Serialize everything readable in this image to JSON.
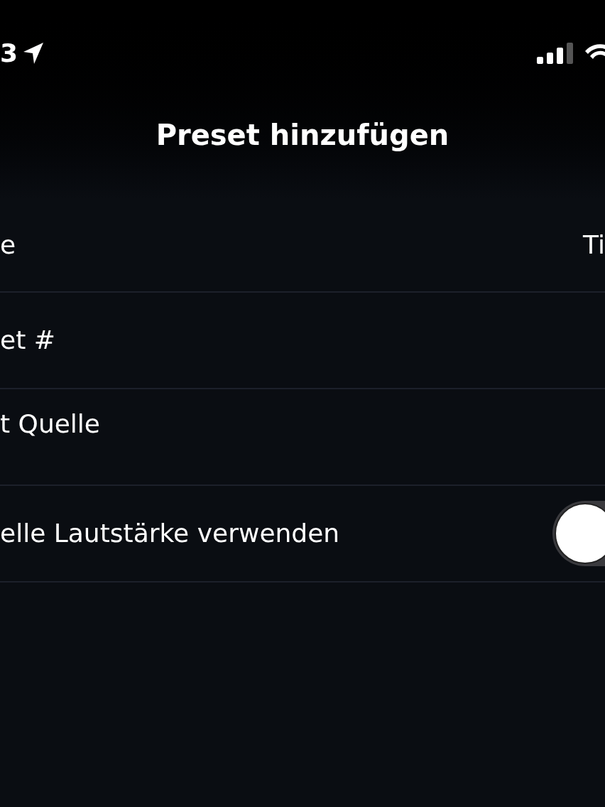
{
  "status_bar": {
    "time": "3"
  },
  "title": "Preset hinzufügen",
  "rows": [
    {
      "kind": "value",
      "label": "e",
      "value": "Ti"
    },
    {
      "kind": "plain",
      "label": "et #"
    },
    {
      "kind": "plain",
      "label": "t Quelle"
    },
    {
      "kind": "toggle",
      "label": "elle Lautstärke verwenden",
      "on": false
    }
  ]
}
